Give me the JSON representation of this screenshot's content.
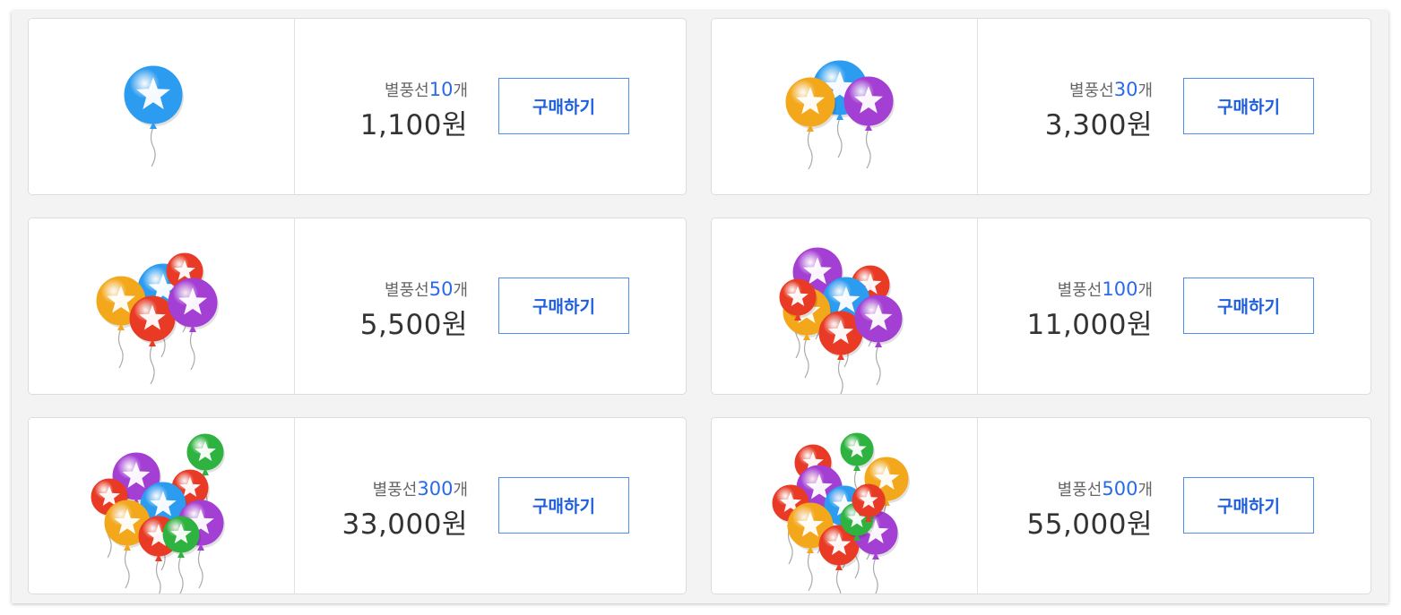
{
  "products": [
    {
      "label_prefix": "별풍선",
      "count": "10",
      "unit": "개",
      "price": "1,100원",
      "buy_label": "구매하기",
      "icon": "balloon-bundle-10-icon"
    },
    {
      "label_prefix": "별풍선",
      "count": "30",
      "unit": "개",
      "price": "3,300원",
      "buy_label": "구매하기",
      "icon": "balloon-bundle-30-icon"
    },
    {
      "label_prefix": "별풍선",
      "count": "50",
      "unit": "개",
      "price": "5,500원",
      "buy_label": "구매하기",
      "icon": "balloon-bundle-50-icon"
    },
    {
      "label_prefix": "별풍선",
      "count": "100",
      "unit": "개",
      "price": "11,000원",
      "buy_label": "구매하기",
      "icon": "balloon-bundle-100-icon"
    },
    {
      "label_prefix": "별풍선",
      "count": "300",
      "unit": "개",
      "price": "33,000원",
      "buy_label": "구매하기",
      "icon": "balloon-bundle-300-icon"
    },
    {
      "label_prefix": "별풍선",
      "count": "500",
      "unit": "개",
      "price": "55,000원",
      "buy_label": "구매하기",
      "icon": "balloon-bundle-500-icon"
    }
  ],
  "colors": {
    "accent": "#2a6ae9",
    "button_border": "#4e8df2",
    "balloon_blue": "#2b9cf0",
    "balloon_orange": "#f3a81c",
    "balloon_purple": "#a43fd3",
    "balloon_red": "#e83a25",
    "balloon_green": "#2fb340"
  }
}
